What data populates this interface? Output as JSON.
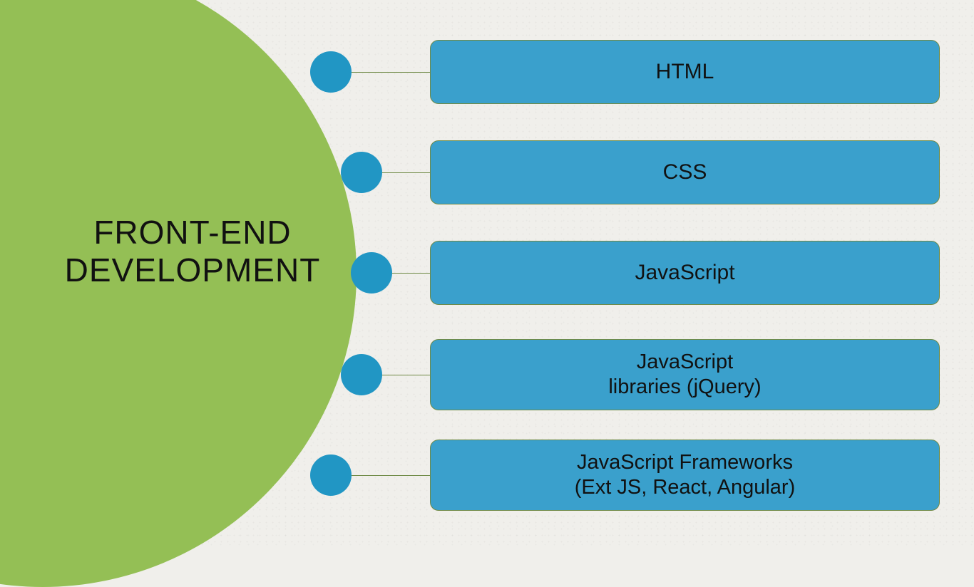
{
  "title_line1": "FRONT-END",
  "title_line2": "DEVELOPMENT",
  "skills": [
    {
      "label": "HTML"
    },
    {
      "label": "CSS"
    },
    {
      "label": "JavaScript"
    },
    {
      "label": "JavaScript\nlibraries (jQuery)"
    },
    {
      "label": "JavaScript Frameworks\n(Ext JS, React, Angular)"
    }
  ],
  "colors": {
    "circle": "#94bf55",
    "node": "#2196c4",
    "box_bg": "#3aa0cc",
    "box_border": "#6f8a46",
    "page_bg": "#f0efeb"
  }
}
